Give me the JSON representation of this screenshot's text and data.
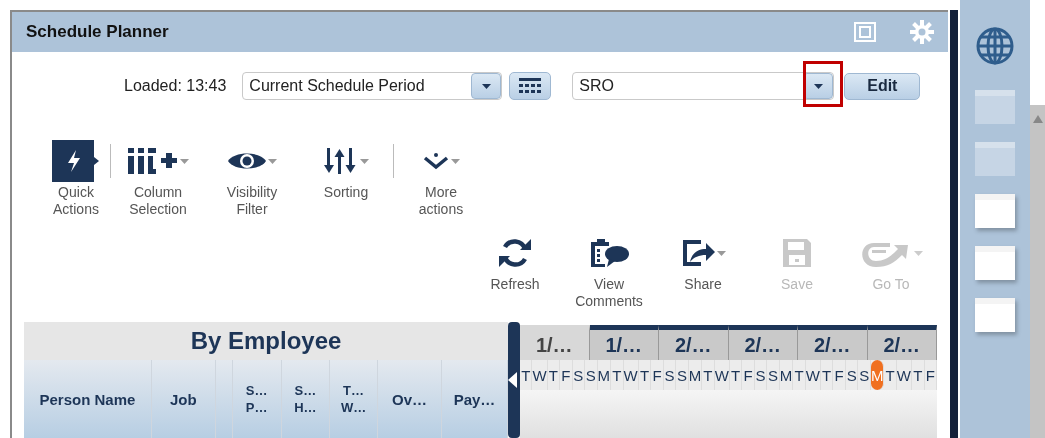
{
  "window": {
    "title": "Schedule Planner"
  },
  "filter_row": {
    "loaded": "Loaded: 13:43",
    "period": {
      "value": "Current Schedule Period"
    },
    "view": {
      "value": "SRO",
      "highlighted": true
    },
    "edit_button": "Edit"
  },
  "toolbar": [
    {
      "kind": "quick",
      "label": "Quick\nActions",
      "dropdown": false,
      "divider_after": true
    },
    {
      "kind": "columns",
      "label": "Column\nSelection",
      "dropdown": true,
      "divider_after": false
    },
    {
      "kind": "eye",
      "label": "Visibility\nFilter",
      "dropdown": true,
      "divider_after": false
    },
    {
      "kind": "sort",
      "label": "Sorting",
      "dropdown": true,
      "divider_after": true
    },
    {
      "kind": "more",
      "label": "More\nactions",
      "dropdown": true,
      "divider_after": false
    }
  ],
  "actions": [
    {
      "kind": "refresh",
      "label": "Refresh",
      "dropdown": false,
      "disabled": false
    },
    {
      "kind": "comments",
      "label": "View\nComments",
      "dropdown": false,
      "disabled": false
    },
    {
      "kind": "share",
      "label": "Share",
      "dropdown": true,
      "disabled": false
    },
    {
      "kind": "save",
      "label": "Save",
      "dropdown": false,
      "disabled": true
    },
    {
      "kind": "goto",
      "label": "Go To",
      "dropdown": true,
      "disabled": true
    }
  ],
  "grid": {
    "title": "By Employee",
    "columns": [
      "Person Name",
      "Job",
      "",
      "S…\nP…",
      "S…\nH…",
      "T…\nW…",
      "Ov…",
      "Pay…"
    ],
    "weeks": [
      {
        "label": "1/…",
        "current": false
      },
      {
        "label": "1/…",
        "current": true
      },
      {
        "label": "2/…",
        "current": true
      },
      {
        "label": "2/…",
        "current": true
      },
      {
        "label": "2/…",
        "current": true
      },
      {
        "label": "2/…",
        "current": true
      }
    ],
    "days": [
      {
        "label": "T",
        "today": false
      },
      {
        "label": "W",
        "today": false
      },
      {
        "label": "T",
        "today": false
      },
      {
        "label": "F",
        "today": false
      },
      {
        "label": "S",
        "today": false
      },
      {
        "label": "S",
        "today": false
      },
      {
        "label": "M",
        "today": false
      },
      {
        "label": "T",
        "today": false
      },
      {
        "label": "W",
        "today": false
      },
      {
        "label": "T",
        "today": false
      },
      {
        "label": "F",
        "today": false
      },
      {
        "label": "S",
        "today": false
      },
      {
        "label": "S",
        "today": false
      },
      {
        "label": "M",
        "today": false
      },
      {
        "label": "T",
        "today": false
      },
      {
        "label": "W",
        "today": false
      },
      {
        "label": "T",
        "today": false
      },
      {
        "label": "F",
        "today": false
      },
      {
        "label": "S",
        "today": false
      },
      {
        "label": "S",
        "today": false
      },
      {
        "label": "M",
        "today": false
      },
      {
        "label": "T",
        "today": false
      },
      {
        "label": "W",
        "today": false
      },
      {
        "label": "T",
        "today": false
      },
      {
        "label": "F",
        "today": false
      },
      {
        "label": "S",
        "today": false
      },
      {
        "label": "S",
        "today": false
      },
      {
        "label": "M",
        "today": true
      },
      {
        "label": "T",
        "today": false
      },
      {
        "label": "W",
        "today": false
      },
      {
        "label": "T",
        "today": false
      },
      {
        "label": "F",
        "today": false
      }
    ]
  },
  "side_panel": {
    "tiles": [
      {
        "active": false
      },
      {
        "active": false
      },
      {
        "active": true
      },
      {
        "active": true
      },
      {
        "active": true
      }
    ]
  }
}
